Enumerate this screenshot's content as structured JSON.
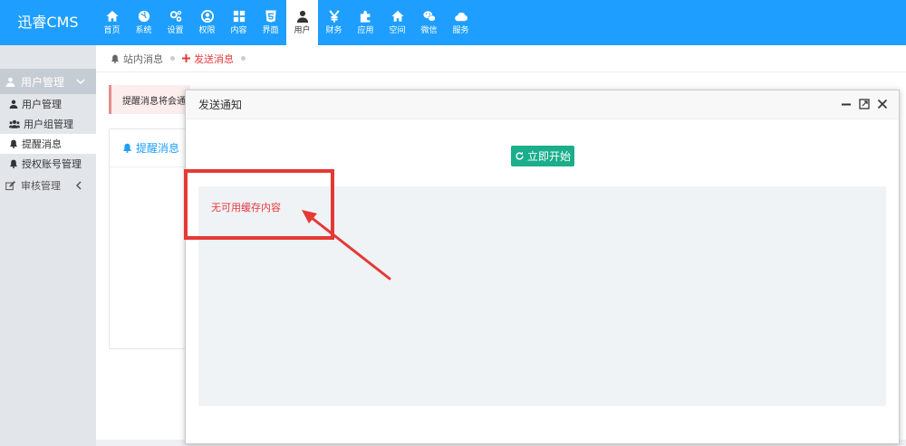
{
  "app": {
    "logo": "迅睿CMS"
  },
  "nav": [
    {
      "label": "首页",
      "icon": "home-icon"
    },
    {
      "label": "系统",
      "icon": "globe-icon"
    },
    {
      "label": "设置",
      "icon": "gears-icon"
    },
    {
      "label": "权限",
      "icon": "user-circle-icon"
    },
    {
      "label": "内容",
      "icon": "grid-icon"
    },
    {
      "label": "界面",
      "icon": "html5-icon"
    },
    {
      "label": "用户",
      "icon": "user-icon",
      "active": true
    },
    {
      "label": "财务",
      "icon": "yen-icon"
    },
    {
      "label": "应用",
      "icon": "puzzle-icon"
    },
    {
      "label": "空间",
      "icon": "home-icon"
    },
    {
      "label": "微信",
      "icon": "wechat-icon"
    },
    {
      "label": "服务",
      "icon": "cloud-icon"
    }
  ],
  "sidebar": {
    "group": "用户管理",
    "items": [
      {
        "label": "用户管理",
        "icon": "user-icon"
      },
      {
        "label": "用户组管理",
        "icon": "users-icon"
      },
      {
        "label": "提醒消息",
        "icon": "bell-icon",
        "active": true
      },
      {
        "label": "授权账号管理",
        "icon": "bell-icon"
      }
    ],
    "group2": "审核管理"
  },
  "breadcrumb": {
    "first": "站内消息",
    "second": "发送消息"
  },
  "alert": {
    "text": "提醒消息将会通过"
  },
  "panel": {
    "title": "提醒消息"
  },
  "modal": {
    "title": "发送通知",
    "start_label": "立即开始",
    "log_text": "无可用缓存内容"
  },
  "colors": {
    "topbar": "#1e9fff",
    "accent_green": "#1aae8b",
    "error_red": "#e4393c",
    "annotation": "#e53935"
  }
}
